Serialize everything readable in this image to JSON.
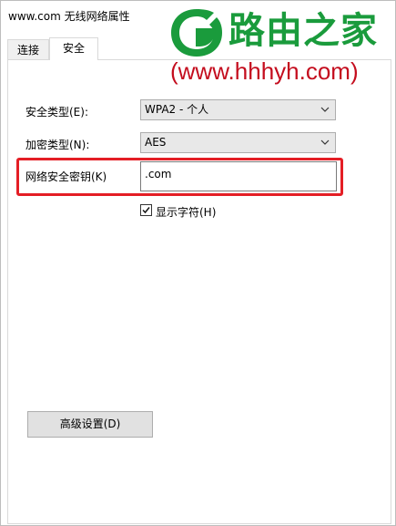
{
  "window": {
    "title": "www.com 无线网络属性"
  },
  "tabs": [
    {
      "label": "连接"
    },
    {
      "label": "安全"
    }
  ],
  "security": {
    "security_type_label": "安全类型(E):",
    "security_type_value": "WPA2 - 个人",
    "encryption_type_label": "加密类型(N):",
    "encryption_type_value": "AES",
    "key_label": "网络安全密钥(K)",
    "key_value": ".com",
    "show_chars_label": "显示字符(H)",
    "show_chars_checked": true,
    "advanced_button": "高级设置(D)"
  },
  "watermark": {
    "brand": "路由之家",
    "url": "(www.hhhyh.com)",
    "brand_color": "#1a9b3c",
    "url_color": "#c40d1e"
  },
  "colors": {
    "highlight": "#e41e25"
  },
  "icons": {
    "dropdown": "chevron-down-icon",
    "checkbox": "checkmark-icon",
    "logo": "leaf-logo-icon"
  }
}
